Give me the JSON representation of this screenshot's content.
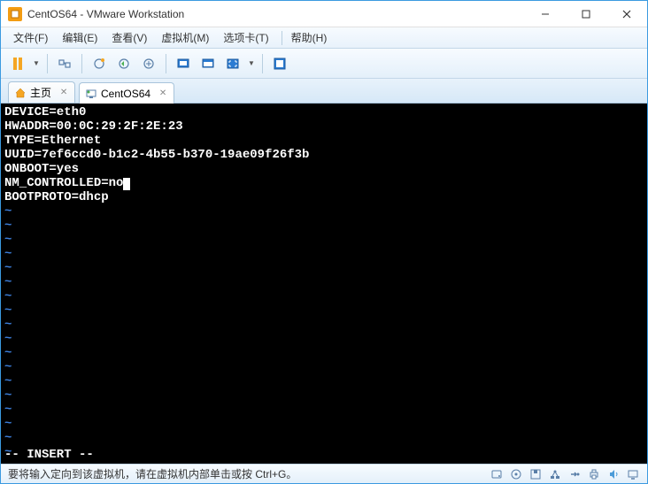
{
  "window": {
    "title": "CentOS64 - VMware Workstation"
  },
  "menu": {
    "file": "文件(F)",
    "edit": "编辑(E)",
    "view": "查看(V)",
    "vm": "虚拟机(M)",
    "tabs": "选项卡(T)",
    "help": "帮助(H)"
  },
  "tabs": {
    "home": "主页",
    "vm": "CentOS64"
  },
  "terminal": {
    "lines": [
      "DEVICE=eth0",
      "HWADDR=00:0C:29:2F:2E:23",
      "TYPE=Ethernet",
      "UUID=7ef6ccd0-b1c2-4b55-b370-19ae09f26f3b",
      "ONBOOT=yes",
      "NM_CONTROLLED=no",
      "BOOTPROTO=dhcp"
    ],
    "status": "-- INSERT --"
  },
  "statusbar": {
    "text": "要将输入定向到该虚拟机，请在虚拟机内部单击或按 Ctrl+G。"
  }
}
